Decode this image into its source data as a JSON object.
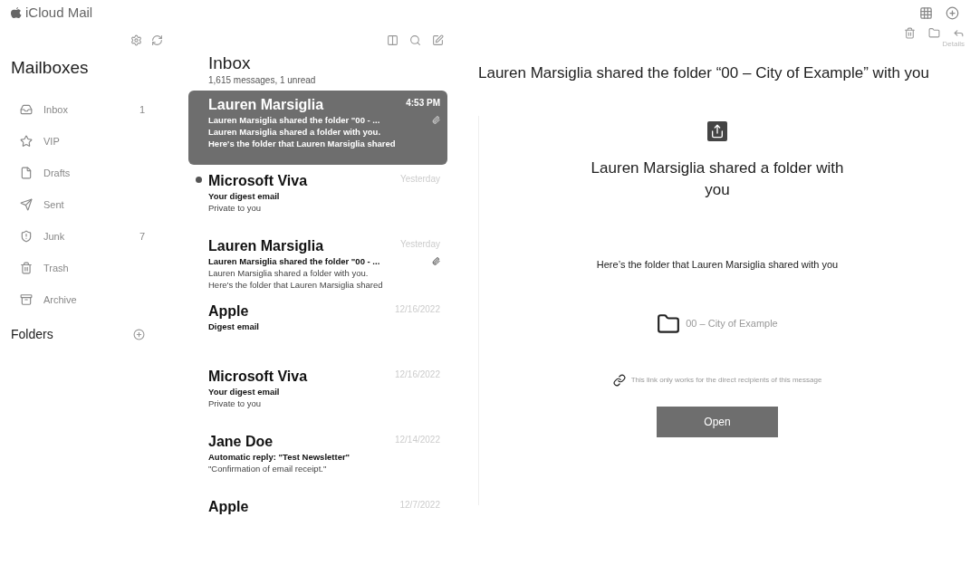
{
  "app": {
    "title": "iCloud Mail"
  },
  "sidebar": {
    "heading": "Mailboxes",
    "items": [
      {
        "kind": "inbox",
        "label": "Inbox",
        "count": "1"
      },
      {
        "kind": "vip",
        "label": "VIP"
      },
      {
        "kind": "drafts",
        "label": "Drafts"
      },
      {
        "kind": "sent",
        "label": "Sent"
      },
      {
        "kind": "junk",
        "label": "Junk",
        "count": "7"
      },
      {
        "kind": "trash",
        "label": "Trash"
      },
      {
        "kind": "archive",
        "label": "Archive"
      }
    ],
    "folders_heading": "Folders"
  },
  "message_list": {
    "title": "Inbox",
    "summary": "1,615 messages, 1 unread",
    "messages": [
      {
        "sender": "Lauren Marsiglia",
        "time": "4:53 PM",
        "subject": "Lauren Marsiglia shared the folder \"00 - ...",
        "preview": [
          "Lauren Marsiglia shared a folder with you.",
          "Here's the folder that Lauren Marsiglia shared"
        ],
        "selected": true,
        "unread": false,
        "attachment": true
      },
      {
        "sender": "Microsoft Viva",
        "time": "Yesterday",
        "subject": "Your digest email",
        "preview": [
          "Private to you"
        ],
        "selected": false,
        "unread": true,
        "attachment": false
      },
      {
        "sender": "Lauren Marsiglia",
        "time": "Yesterday",
        "subject": "Lauren Marsiglia  shared the folder \"00 - ...",
        "preview": [
          "Lauren Marsiglia shared a folder with you.",
          "Here's the folder that Lauren Marsiglia shared"
        ],
        "selected": false,
        "unread": false,
        "attachment": true
      },
      {
        "sender": "Apple",
        "time": "12/16/2022",
        "subject": "Digest email",
        "selected": false,
        "unread": false,
        "attachment": false
      },
      {
        "sender": "Microsoft Viva",
        "time": "12/16/2022",
        "subject": "Your digest email",
        "preview": [
          "Private to you"
        ],
        "selected": false,
        "unread": false,
        "attachment": false
      },
      {
        "sender": "Jane Doe",
        "time": "12/14/2022",
        "subject": "Automatic reply: \"Test Newsletter\"",
        "preview": [
          "\"Confirmation of email receipt.\""
        ],
        "selected": false,
        "unread": false,
        "attachment": false
      },
      {
        "sender": "Apple",
        "time": "12/7/2022",
        "selected": false,
        "unread": false,
        "attachment": false
      }
    ]
  },
  "reader": {
    "details_label": "Details",
    "subject": "Lauren Marsiglia shared the folder “00 – City of Example” with you",
    "card": {
      "heading": "Lauren Marsiglia shared a folder with you",
      "text": "Here’s the folder that Lauren Marsiglia shared with you",
      "folder_name": "00 – City of Example",
      "note": "This link only works for the direct recipients of this message",
      "button": "Open"
    }
  }
}
